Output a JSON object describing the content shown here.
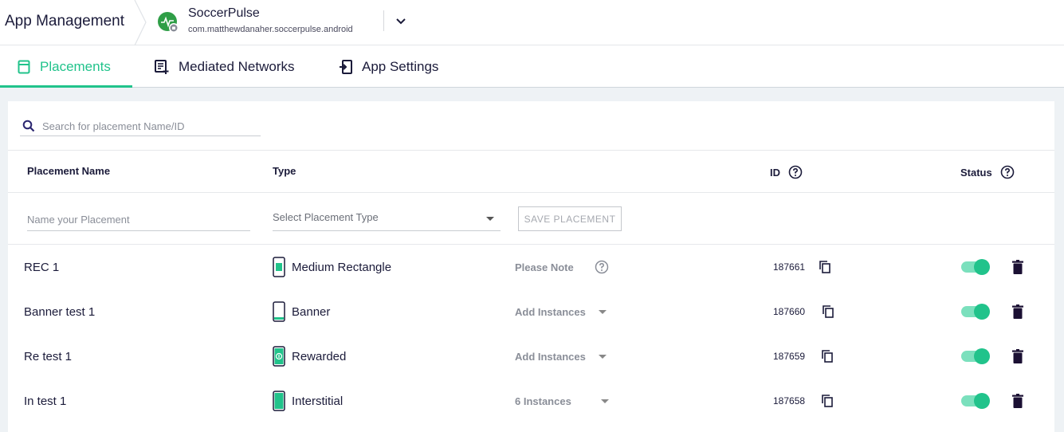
{
  "header": {
    "breadcrumb": "App Management",
    "app_name": "SoccerPulse",
    "app_package": "com.matthewdanaher.soccerpulse.android"
  },
  "tabs": [
    {
      "label": "Placements",
      "icon": "placements-icon",
      "active": true
    },
    {
      "label": "Mediated Networks",
      "icon": "mediated-networks-icon",
      "active": false
    },
    {
      "label": "App Settings",
      "icon": "app-settings-icon",
      "active": false
    }
  ],
  "search": {
    "placeholder": "Search for placement Name/ID"
  },
  "table": {
    "columns": {
      "name": "Placement Name",
      "type": "Type",
      "id": "ID",
      "status": "Status"
    },
    "new_row": {
      "name_placeholder": "Name your Placement",
      "type_placeholder": "Select Placement Type",
      "save_label": "SAVE PLACEMENT"
    },
    "rows": [
      {
        "name": "REC 1",
        "type": "Medium Rectangle",
        "type_icon": "medium-rectangle-icon",
        "note": "Please Note",
        "id": "187661",
        "enabled": true
      },
      {
        "name": "Banner test 1",
        "type": "Banner",
        "type_icon": "banner-icon",
        "note": "Add Instances",
        "id": "187660",
        "enabled": true
      },
      {
        "name": "Re test 1",
        "type": "Rewarded",
        "type_icon": "rewarded-icon",
        "note": "Add Instances",
        "id": "187659",
        "enabled": true
      },
      {
        "name": "In test 1",
        "type": "Interstitial",
        "type_icon": "interstitial-icon",
        "note": "6 Instances",
        "id": "187658",
        "enabled": true
      }
    ]
  },
  "colors": {
    "accent": "#21c38b",
    "text": "#1b1b3a",
    "background": "#eef2f5"
  }
}
